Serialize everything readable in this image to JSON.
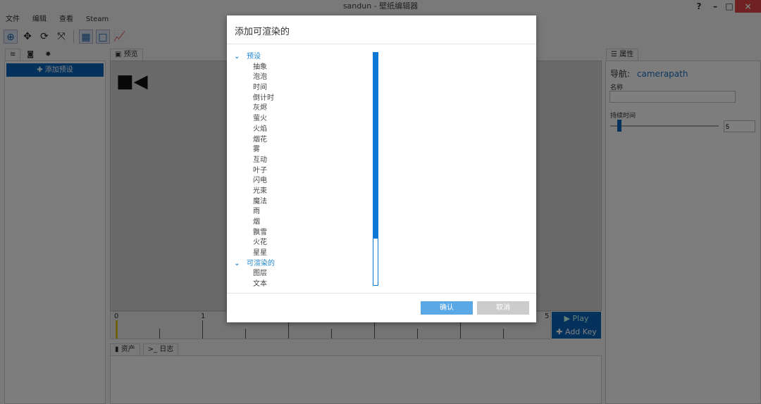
{
  "window": {
    "title": "sandun - 壁纸编辑器",
    "help": "?",
    "minimize": "–",
    "maximize": "□",
    "close": "×"
  },
  "menu": [
    "文件",
    "编辑",
    "查看",
    "Steam"
  ],
  "left_panel": {
    "add_preset": "添加预设"
  },
  "preview": {
    "tab": "预览"
  },
  "timeline": {
    "ticks": [
      "0",
      "1",
      "5"
    ],
    "play": "Play",
    "add_key": "Add Key"
  },
  "bottom_tabs": [
    "资产",
    "日志"
  ],
  "properties": {
    "tab": "属性",
    "nav_label": "导航:",
    "nav_value": "camerapath",
    "name_label": "名称",
    "name_value": "",
    "duration_label": "持续时间",
    "duration_value": "5",
    "duration_slider_fraction": 0.05
  },
  "dialog": {
    "title": "添加可渲染的",
    "groups": [
      {
        "label": "预设",
        "items": [
          "抽象",
          "泡泡",
          "时间",
          "倒计时",
          "灰烬",
          "萤火",
          "火焰",
          "烟花",
          "雾",
          "互动",
          "叶子",
          "闪电",
          "光束",
          "魔法",
          "雨",
          "烟",
          "飘雪",
          "火花",
          "星星"
        ]
      },
      {
        "label": "可渲染的",
        "items": [
          "图层",
          "文本"
        ]
      }
    ],
    "confirm": "确认",
    "cancel": "取消"
  },
  "colors": {
    "accent": "#0a78d4",
    "close": "#e04343",
    "confirm": "#5aa9e6",
    "cancel": "#cccccc"
  }
}
